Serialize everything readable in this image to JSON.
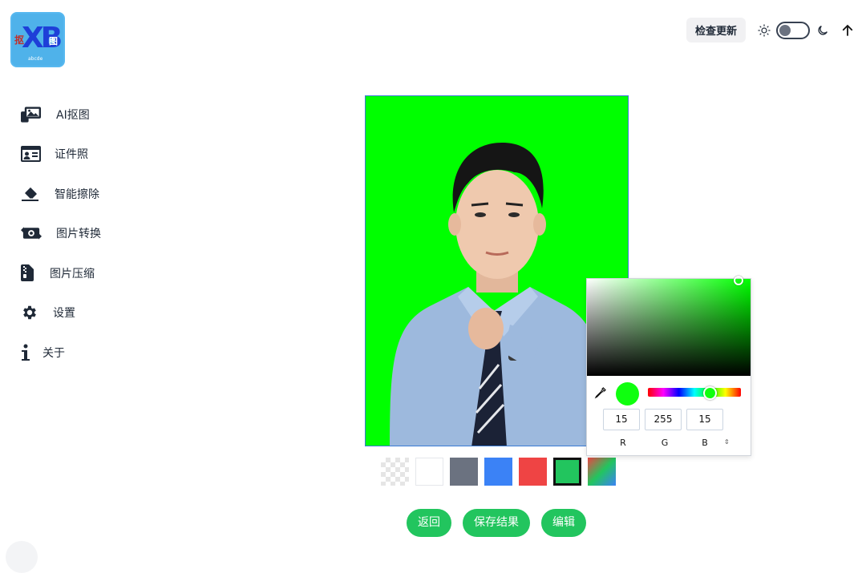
{
  "logo": {
    "text": "XB",
    "char_left": "抠",
    "char_right": "图",
    "sub": "abcde"
  },
  "header": {
    "update_button": "检查更新"
  },
  "sidebar": {
    "items": [
      {
        "label": "AI抠图",
        "icon": "images-icon"
      },
      {
        "label": "证件照",
        "icon": "id-card-icon"
      },
      {
        "label": "智能擦除",
        "icon": "eraser-icon"
      },
      {
        "label": "图片转换",
        "icon": "convert-icon"
      },
      {
        "label": "图片压缩",
        "icon": "file-zipper-icon"
      },
      {
        "label": "设置",
        "icon": "gear-icon"
      },
      {
        "label": "关于",
        "icon": "info-icon"
      }
    ]
  },
  "photo": {
    "background_color": "#00ff00"
  },
  "swatches": [
    {
      "name": "transparent"
    },
    {
      "name": "white",
      "color": "#ffffff"
    },
    {
      "name": "gray",
      "color": "#6b7280"
    },
    {
      "name": "blue",
      "color": "#3b82f6"
    },
    {
      "name": "red",
      "color": "#ef4444"
    },
    {
      "name": "green",
      "color": "#22c55e",
      "selected": true
    },
    {
      "name": "custom"
    }
  ],
  "actions": {
    "back": "返回",
    "save": "保存结果",
    "edit": "编辑"
  },
  "picker": {
    "r": "15",
    "g": "255",
    "b": "15",
    "r_label": "R",
    "g_label": "G",
    "b_label": "B",
    "mode_toggle": "⇕"
  }
}
